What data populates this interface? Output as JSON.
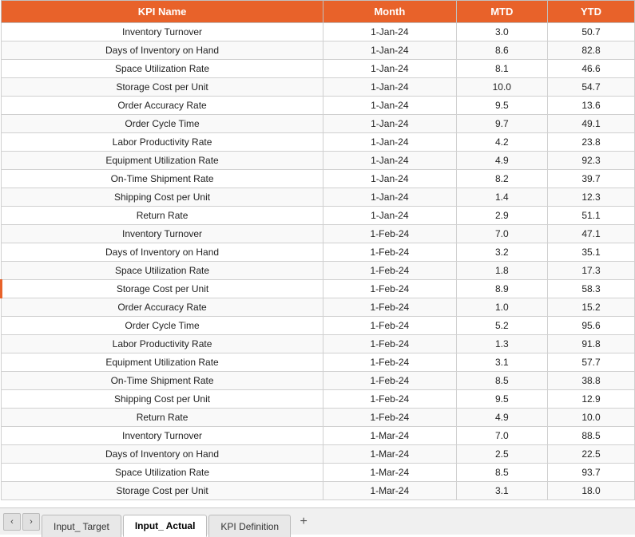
{
  "header": {
    "cols": [
      "KPI Name",
      "Month",
      "MTD",
      "YTD"
    ]
  },
  "rows": [
    {
      "kpi": "Inventory Turnover",
      "month": "1-Jan-24",
      "mtd": "3.0",
      "ytd": "50.7",
      "highlight": false
    },
    {
      "kpi": "Days of Inventory on Hand",
      "month": "1-Jan-24",
      "mtd": "8.6",
      "ytd": "82.8",
      "highlight": false
    },
    {
      "kpi": "Space Utilization Rate",
      "month": "1-Jan-24",
      "mtd": "8.1",
      "ytd": "46.6",
      "highlight": false
    },
    {
      "kpi": "Storage Cost per Unit",
      "month": "1-Jan-24",
      "mtd": "10.0",
      "ytd": "54.7",
      "highlight": false
    },
    {
      "kpi": "Order Accuracy Rate",
      "month": "1-Jan-24",
      "mtd": "9.5",
      "ytd": "13.6",
      "highlight": false
    },
    {
      "kpi": "Order Cycle Time",
      "month": "1-Jan-24",
      "mtd": "9.7",
      "ytd": "49.1",
      "highlight": false
    },
    {
      "kpi": "Labor Productivity Rate",
      "month": "1-Jan-24",
      "mtd": "4.2",
      "ytd": "23.8",
      "highlight": false
    },
    {
      "kpi": "Equipment Utilization Rate",
      "month": "1-Jan-24",
      "mtd": "4.9",
      "ytd": "92.3",
      "highlight": false
    },
    {
      "kpi": "On-Time Shipment Rate",
      "month": "1-Jan-24",
      "mtd": "8.2",
      "ytd": "39.7",
      "highlight": false
    },
    {
      "kpi": "Shipping Cost per Unit",
      "month": "1-Jan-24",
      "mtd": "1.4",
      "ytd": "12.3",
      "highlight": false
    },
    {
      "kpi": "Return Rate",
      "month": "1-Jan-24",
      "mtd": "2.9",
      "ytd": "51.1",
      "highlight": false
    },
    {
      "kpi": "Inventory Turnover",
      "month": "1-Feb-24",
      "mtd": "7.0",
      "ytd": "47.1",
      "highlight": false
    },
    {
      "kpi": "Days of Inventory on Hand",
      "month": "1-Feb-24",
      "mtd": "3.2",
      "ytd": "35.1",
      "highlight": false
    },
    {
      "kpi": "Space Utilization Rate",
      "month": "1-Feb-24",
      "mtd": "1.8",
      "ytd": "17.3",
      "highlight": false
    },
    {
      "kpi": "Storage Cost per Unit",
      "month": "1-Feb-24",
      "mtd": "8.9",
      "ytd": "58.3",
      "highlight": true
    },
    {
      "kpi": "Order Accuracy Rate",
      "month": "1-Feb-24",
      "mtd": "1.0",
      "ytd": "15.2",
      "highlight": false
    },
    {
      "kpi": "Order Cycle Time",
      "month": "1-Feb-24",
      "mtd": "5.2",
      "ytd": "95.6",
      "highlight": false
    },
    {
      "kpi": "Labor Productivity Rate",
      "month": "1-Feb-24",
      "mtd": "1.3",
      "ytd": "91.8",
      "highlight": false
    },
    {
      "kpi": "Equipment Utilization Rate",
      "month": "1-Feb-24",
      "mtd": "3.1",
      "ytd": "57.7",
      "highlight": false
    },
    {
      "kpi": "On-Time Shipment Rate",
      "month": "1-Feb-24",
      "mtd": "8.5",
      "ytd": "38.8",
      "highlight": false
    },
    {
      "kpi": "Shipping Cost per Unit",
      "month": "1-Feb-24",
      "mtd": "9.5",
      "ytd": "12.9",
      "highlight": false
    },
    {
      "kpi": "Return Rate",
      "month": "1-Feb-24",
      "mtd": "4.9",
      "ytd": "10.0",
      "highlight": false
    },
    {
      "kpi": "Inventory Turnover",
      "month": "1-Mar-24",
      "mtd": "7.0",
      "ytd": "88.5",
      "highlight": false
    },
    {
      "kpi": "Days of Inventory on Hand",
      "month": "1-Mar-24",
      "mtd": "2.5",
      "ytd": "22.5",
      "highlight": false
    },
    {
      "kpi": "Space Utilization Rate",
      "month": "1-Mar-24",
      "mtd": "8.5",
      "ytd": "93.7",
      "highlight": false
    },
    {
      "kpi": "Storage Cost per Unit",
      "month": "1-Mar-24",
      "mtd": "3.1",
      "ytd": "18.0",
      "highlight": false
    }
  ],
  "tabs": [
    {
      "label": "Input_ Target",
      "active": false
    },
    {
      "label": "Input_ Actual",
      "active": true
    },
    {
      "label": "KPI Definition",
      "active": false
    }
  ],
  "tab_add_label": "+",
  "nav_prev": "‹",
  "nav_next": "›"
}
